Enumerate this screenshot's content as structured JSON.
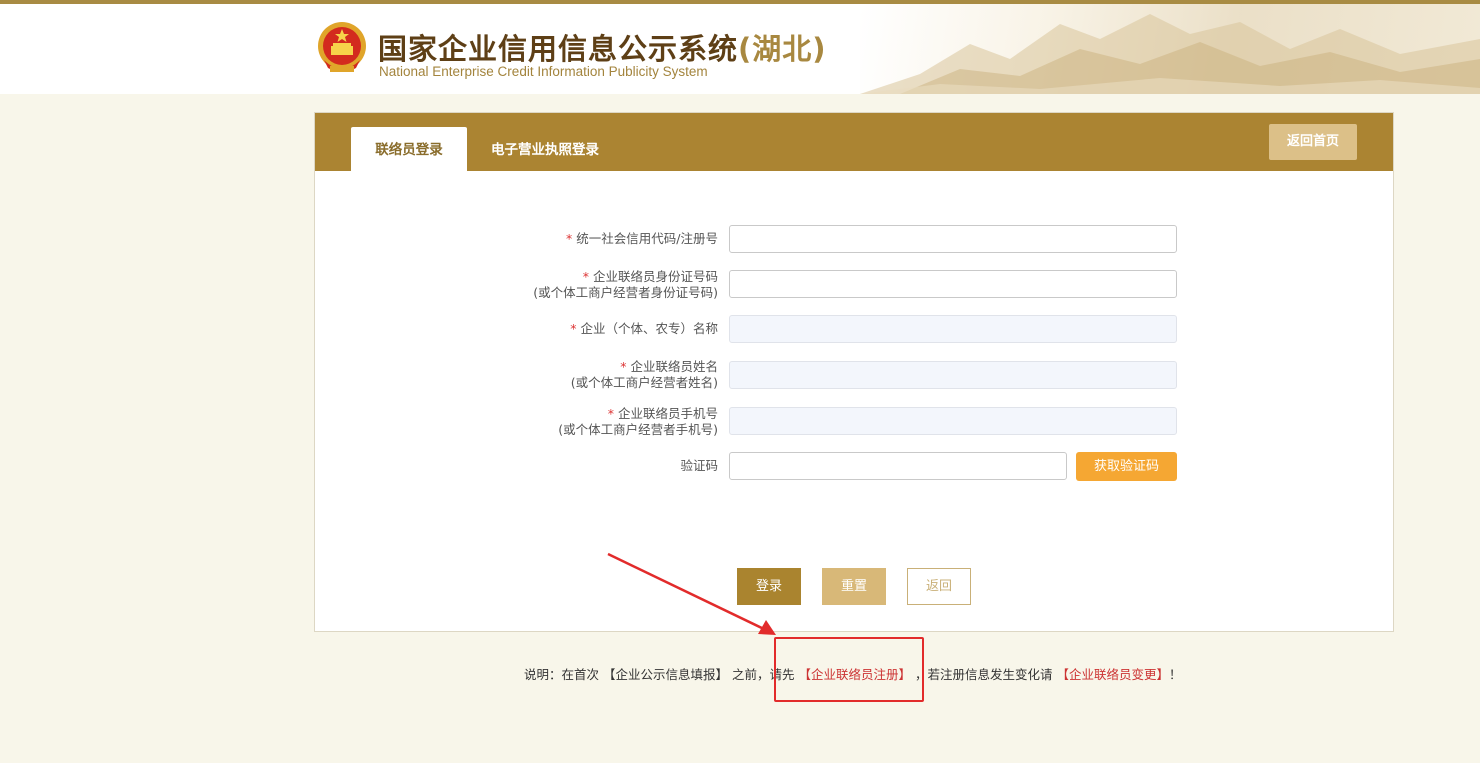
{
  "header": {
    "title_main": "国家企业信用信息公示系统",
    "title_region": "(湖北)",
    "title_en": "National Enterprise Credit Information Publicity System",
    "emblem_icon": "national-emblem-icon"
  },
  "tabs": [
    {
      "label": "联络员登录",
      "active": true
    },
    {
      "label": "电子营业执照登录",
      "active": false
    }
  ],
  "home_button": "返回首页",
  "form": {
    "fields": [
      {
        "required": "*",
        "label_line1": "统一社会信用代码/注册号",
        "label_line2": "",
        "value": "",
        "disabled": false
      },
      {
        "required": "*",
        "label_line1": "企业联络员身份证号码",
        "label_line2": "(或个体工商户经营者身份证号码)",
        "value": "",
        "disabled": false
      },
      {
        "required": "*",
        "label_line1": "企业（个体、农专）名称",
        "label_line2": "",
        "value": "",
        "disabled": true
      },
      {
        "required": "*",
        "label_line1": "企业联络员姓名",
        "label_line2": "(或个体工商户经营者姓名)",
        "value": "",
        "disabled": true
      },
      {
        "required": "*",
        "label_line1": "企业联络员手机号",
        "label_line2": "(或个体工商户经营者手机号)",
        "value": "",
        "disabled": true
      }
    ],
    "captcha": {
      "label": "验证码",
      "value": "",
      "button": "获取验证码"
    }
  },
  "actions": {
    "login": "登录",
    "reset": "重置",
    "back": "返回"
  },
  "note": {
    "prefix": "说明：在首次 【企业公示信息填报】 之前，请先",
    "register_link": "【企业联络员注册】",
    "middle": "，若注册信息发生变化请",
    "change_link": "【企业联络员变更】",
    "suffix": "！"
  },
  "colors": {
    "brand": "#ab8432",
    "accent_orange": "#f5a733",
    "annotation_red": "#e22b2b"
  }
}
